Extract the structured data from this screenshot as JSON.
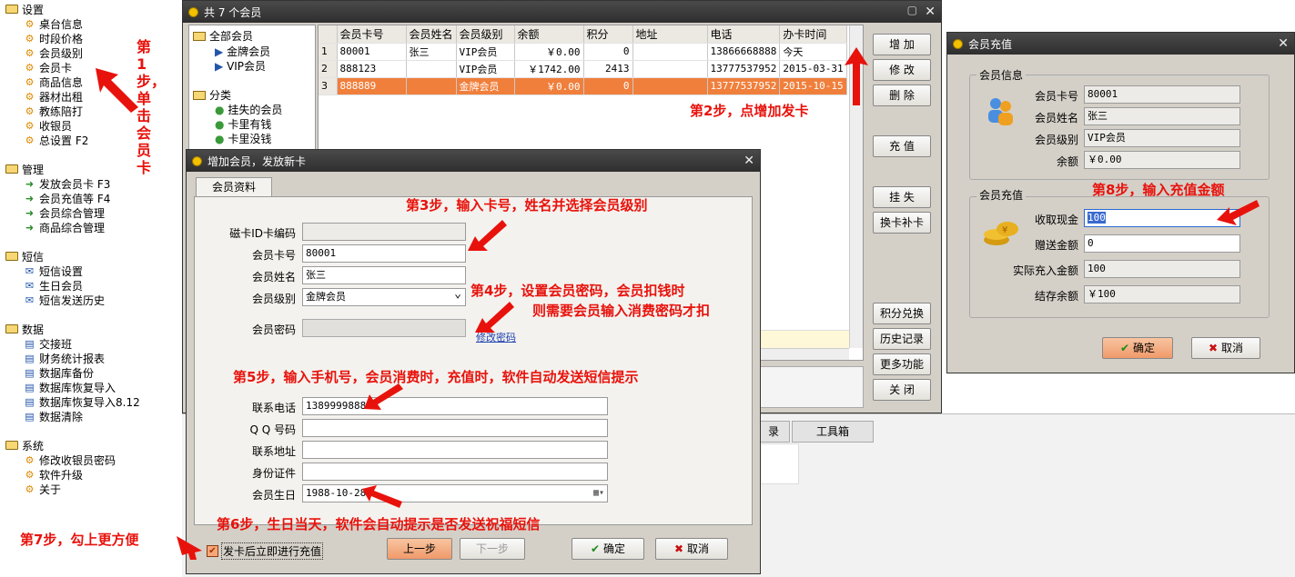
{
  "tree": {
    "groups": [
      {
        "label": "设置",
        "items": [
          "桌台信息",
          "时段价格",
          "会员级别",
          "会员卡",
          "商品信息",
          "器材出租",
          "教练陪打",
          "收银员",
          "总设置 F2"
        ]
      },
      {
        "label": "管理",
        "items": [
          "发放会员卡 F3",
          "会员充值等 F4",
          "会员综合管理",
          "商品综合管理"
        ]
      },
      {
        "label": "短信",
        "items": [
          "短信设置",
          "生日会员",
          "短信发送历史"
        ]
      },
      {
        "label": "数据",
        "items": [
          "交接班",
          "财务统计报表",
          "数据库备份",
          "数据库恢复导入",
          "数据库恢复导入8.12",
          "数据清除"
        ]
      },
      {
        "label": "系统",
        "items": [
          "修改收银员密码",
          "软件升级",
          "关于"
        ]
      }
    ]
  },
  "annotations": {
    "step1": "第1步，单击会员卡",
    "step2": "第2步，点增加发卡",
    "step3": "第3步，输入卡号，姓名并选择会员级别",
    "step4a": "第4步，设置会员密码，会员扣钱时",
    "step4b": "则需要会员输入消费密码才扣",
    "step5": "第5步，输入手机号，会员消费时，充值时，软件自动发送短信提示",
    "step6": "第6步，生日当天，软件会自动提示是否发送祝福短信",
    "step7": "第7步，勾上更方便",
    "step8": "第8步，输入充值金额"
  },
  "members_window": {
    "title": "共 7 个会员",
    "filter_tree": {
      "all": "全部会员",
      "levels": [
        "金牌会员",
        "VIP会员"
      ],
      "category": "分类",
      "cats": [
        "挂失的会员",
        "卡里有钱",
        "卡里没钱"
      ]
    },
    "columns": [
      "会员卡号",
      "会员姓名",
      "会员级别",
      "余额",
      "积分",
      "地址",
      "电话",
      "办卡时间"
    ],
    "rows": [
      {
        "n": "1",
        "card": "80001",
        "name": "张三",
        "level": "VIP会员",
        "balance": "￥0.00",
        "points": "0",
        "addr": "",
        "phone": "13866668888",
        "date": "今天"
      },
      {
        "n": "2",
        "card": "888123",
        "name": "",
        "level": "VIP会员",
        "balance": "￥1742.00",
        "points": "2413",
        "addr": "",
        "phone": "13777537952",
        "date": "2015-03-31"
      },
      {
        "n": "3",
        "card": "888889",
        "name": "",
        "level": "金牌会员",
        "balance": "￥0.00",
        "points": "0",
        "addr": "",
        "phone": "13777537952",
        "date": "2015-10-15"
      }
    ],
    "buttons": [
      "增 加",
      "修 改",
      "删 除",
      "充 值",
      "挂 失",
      "换卡补卡",
      "积分兑换",
      "历史记录",
      "更多功能",
      "关 闭"
    ]
  },
  "bg_tabs": {
    "tab1": "录",
    "tab2": "工具箱"
  },
  "add_window": {
    "title": "增加会员，发放新卡",
    "tab": "会员资料",
    "labels": {
      "magid": "磁卡ID卡编码",
      "card": "会员卡号",
      "name": "会员姓名",
      "level": "会员级别",
      "pwd": "会员密码",
      "phone": "联系电话",
      "qq": "Q Q 号码",
      "addr": "联系地址",
      "idcard": "身份证件",
      "birthday": "会员生日"
    },
    "values": {
      "magid": "",
      "card": "80001",
      "name": "张三",
      "level": "金牌会员",
      "pwd": "",
      "phone": "13899998888",
      "qq": "",
      "addr": "",
      "idcard": "",
      "birthday": "1988-10-28"
    },
    "change_pwd": "修改密码",
    "checkbox": "发卡后立即进行充值",
    "prev": "上一步",
    "next": "下一步",
    "ok": "确定",
    "cancel": "取消"
  },
  "recharge_window": {
    "title": "会员充值",
    "info_group": "会员信息",
    "info": [
      {
        "label": "会员卡号",
        "value": "80001"
      },
      {
        "label": "会员姓名",
        "value": "张三"
      },
      {
        "label": "会员级别",
        "value": "VIP会员"
      },
      {
        "label": "余额",
        "value": "￥0.00"
      }
    ],
    "recharge_group": "会员充值",
    "fields": [
      {
        "label": "收取现金",
        "value": "100"
      },
      {
        "label": "赠送金额",
        "value": "0"
      },
      {
        "label": "实际充入金额",
        "value": "100"
      },
      {
        "label": "结存余额",
        "value": "￥100"
      }
    ],
    "ok": "确定",
    "cancel": "取消"
  },
  "colors": {
    "annotation": "#e8120c",
    "selected_row": "#f07f3c",
    "title_bar": "#3a3a3a"
  }
}
